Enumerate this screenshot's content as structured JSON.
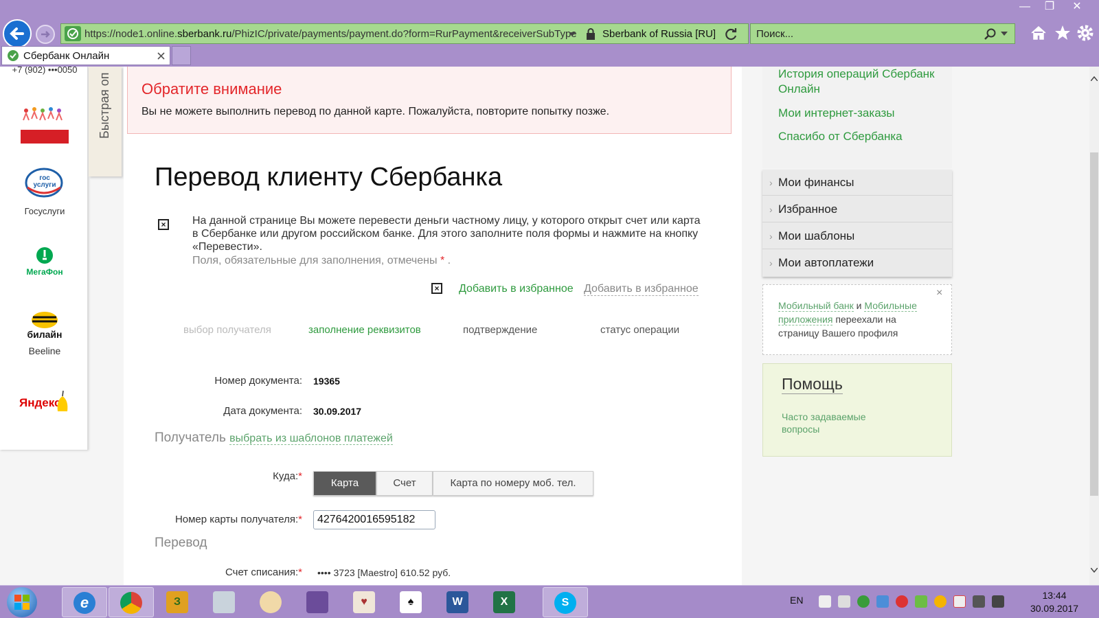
{
  "browser": {
    "url_prefix": "https://node1.online.",
    "url_domain": "sberbank.ru",
    "url_path": "/PhizIC/private/payments/payment.do?form=RurPayment&receiverSubType",
    "site_identity": "Sberbank of Russia [RU]",
    "search_placeholder": "Поиск...",
    "tab_title": "Сбербанк Онлайн",
    "minimize": "—",
    "restore": "❐",
    "close": "✕"
  },
  "left_panel": {
    "phone": "+7 (902) •••0050",
    "quick_label": "Быстрая оп",
    "partners": [
      {
        "name": "",
        "icon": "dobro-icon"
      },
      {
        "name": "Госуслуги",
        "icon": "gosuslugi-icon"
      },
      {
        "name": "",
        "icon": "megafon-icon"
      },
      {
        "name": "Beeline",
        "icon": "beeline-icon"
      },
      {
        "name": "",
        "icon": "yandex-icon"
      }
    ],
    "gos_logo_text": "гос услуги",
    "megafon_logo_text": "МегаФон",
    "beeline_logo_text": "билайн",
    "yandex_logo_text": "Яндекс"
  },
  "alert": {
    "title": "Обратите внимание",
    "text": "Вы не можете выполнить перевод по данной карте. Пожалуйста, повторите попытку позже."
  },
  "main": {
    "title": "Перевод клиенту Сбербанка",
    "intro": "На данной странице Вы можете перевести деньги частному лицу, у которого открыт счет или карта в Сбербанке или другом российском банке. Для этого заполните поля формы и нажмите на кнопку «Перевести».",
    "required_note": "Поля, обязательные для заполнения, отмечены",
    "required_star": "*",
    "required_dot": ".",
    "fav_green": "Добавить в избранное",
    "fav_gray": "Добавить в избранное",
    "steps": [
      {
        "label": "выбор получателя",
        "state": "done"
      },
      {
        "label": "заполнение реквизитов",
        "state": "current"
      },
      {
        "label": "подтверждение",
        "state": "todo"
      },
      {
        "label": "статус операции",
        "state": "todo"
      }
    ],
    "doc_number_label": "Номер документа:",
    "doc_number": "19365",
    "doc_date_label": "Дата документа:",
    "doc_date": "30.09.2017",
    "recipient_section": "Получатель",
    "recipient_link": "выбрать из шаблонов платежей",
    "where_label": "Куда:",
    "where_options": [
      "Карта",
      "Счет",
      "Карта по номеру моб. тел."
    ],
    "where_selected": "Карта",
    "card_label": "Номер карты получателя:",
    "card_value": "4276420016595182",
    "transfer_section": "Перевод",
    "debit_label": "Счет списания:",
    "debit_value": "•••• 3723 [Maestro] 610.52 руб."
  },
  "right": {
    "links": [
      "История операций Сбербанк Онлайн",
      "Мои интернет-заказы",
      "Спасибо от Сбербанка"
    ],
    "menu": [
      "Мои финансы",
      "Избранное",
      "Мои шаблоны",
      "Мои автоплатежи"
    ],
    "notice_link1": "Мобильный банк",
    "notice_and": " и ",
    "notice_link2": "Мобильные приложения",
    "notice_rest": " переехали на страницу Вашего профиля",
    "notice_close": "×",
    "help_title": "Помощь",
    "help_link": "Часто задаваемые вопросы"
  },
  "taskbar": {
    "lang": "EN",
    "time": "13:44",
    "date": "30.09.2017",
    "apps": [
      "internet-explorer",
      "chrome",
      "game-app",
      "calculator",
      "paint",
      "spider-solitaire",
      "solitaire",
      "word",
      "excel",
      "skype"
    ]
  },
  "colors": {
    "accent_green": "#2e9a3e",
    "alert_red": "#e3262a",
    "chrome_purple": "#a88fcb"
  }
}
